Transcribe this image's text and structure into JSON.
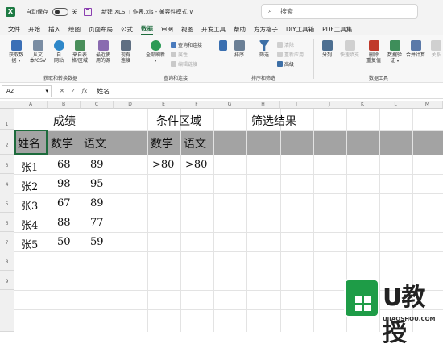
{
  "titlebar": {
    "autosave_label": "自动保存",
    "toggle_state": "关",
    "filename": "新建 XLS 工作表.xls  -  兼容性模式 ∨",
    "search_placeholder": "搜索"
  },
  "menu": [
    "文件",
    "开始",
    "插入",
    "绘图",
    "页面布局",
    "公式",
    "数据",
    "审阅",
    "视图",
    "开发工具",
    "帮助",
    "方方格子",
    "DIY工具箱",
    "PDF工具集"
  ],
  "active_menu": "数据",
  "ribbon": {
    "get_transform": {
      "label": "获取和转换数据",
      "buttons": [
        "获取数\n据 ▾",
        "从文\n本/CSV",
        "自\n网站",
        "来自表\n格/区域",
        "最近使\n用的源",
        "现有\n连接"
      ]
    },
    "queries": {
      "label": "查询和连接",
      "refresh": "全部刷新\n▾",
      "items": [
        "查询和连接",
        "属性",
        "编辑链接"
      ]
    },
    "sort_filter": {
      "label": "排序和筛选",
      "sort": "排序",
      "filter": "筛选",
      "items": [
        "清除",
        "重新应用",
        "高级"
      ]
    },
    "data_tools": {
      "label": "数据工具",
      "buttons": [
        "分列",
        "快速填充",
        "删除\n重复值",
        "数据验\n证 ▾",
        "合并计算",
        "关系"
      ]
    }
  },
  "formula_bar": {
    "cell_ref": "A2",
    "fx": "fx",
    "value": "姓名"
  },
  "columns": [
    "A",
    "B",
    "C",
    "D",
    "E",
    "F",
    "G",
    "H",
    "I",
    "J",
    "K",
    "L",
    "M"
  ],
  "rows": [
    "1",
    "2",
    "3",
    "4",
    "5",
    "6",
    "7",
    "8",
    "9"
  ],
  "sheet": {
    "h_scores": "成绩",
    "h_criteria": "条件区域",
    "h_results": "筛选结果",
    "col_name": "姓名",
    "col_math": "数学",
    "col_chinese": "语文",
    "crit_math": "数学",
    "crit_chinese": "语文",
    "crit_math_val": ">80",
    "crit_chinese_val": ">80",
    "records": [
      {
        "name": "张1",
        "math": "68",
        "chinese": "89"
      },
      {
        "name": "张2",
        "math": "98",
        "chinese": "95"
      },
      {
        "name": "张3",
        "math": "67",
        "chinese": "89"
      },
      {
        "name": "张4",
        "math": "88",
        "chinese": "77"
      },
      {
        "name": "张5",
        "math": "50",
        "chinese": "59"
      }
    ]
  },
  "watermark": {
    "brand": "U教授",
    "url": "UJIAOSHOU.COM"
  },
  "colors": {
    "accent": "#1d6b3c",
    "header_row_fill": "#a3a3a3",
    "watermark_green": "#1e9c47"
  }
}
